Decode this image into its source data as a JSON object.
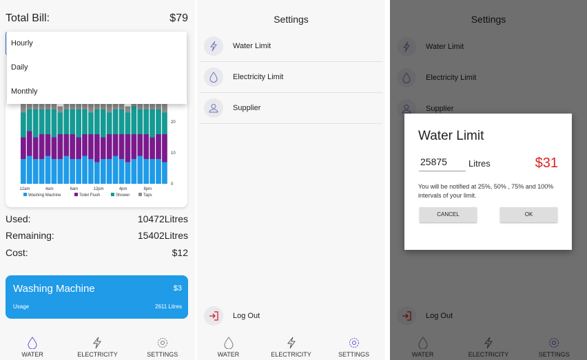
{
  "panel1": {
    "total_label": "Total Bill:",
    "total_value": "$79",
    "dropdown_options": [
      "Hourly",
      "Daily",
      "Monthly"
    ],
    "stats": [
      {
        "label": "Used:",
        "value": "10472Litres"
      },
      {
        "label": "Remaining:",
        "value": "15402Litres"
      },
      {
        "label": "Cost:",
        "value": "$12"
      }
    ],
    "card": {
      "title": "Washing Machine",
      "price": "$3",
      "usage_label": "Usage",
      "usage_value": "2611 Litres"
    }
  },
  "chart_data": {
    "type": "bar",
    "stacked": true,
    "x_tick_labels": [
      "12am",
      "4am",
      "8am",
      "12pm",
      "4pm",
      "8pm"
    ],
    "y_tick_labels": [
      "0",
      "10",
      "20"
    ],
    "legend": [
      "Washing Machine",
      "Toilet Flush",
      "Shower",
      "Taps"
    ],
    "colors": [
      "#1f9be7",
      "#7b1a8c",
      "#159a94",
      "#8c8c8c"
    ],
    "series": [
      {
        "name": "Washing Machine",
        "values": [
          8,
          9,
          8,
          8,
          9,
          8,
          8,
          9,
          8,
          8,
          9,
          8,
          7,
          8,
          8,
          9,
          8,
          7,
          8,
          9,
          8,
          8,
          8,
          7
        ]
      },
      {
        "name": "Toilet Flush",
        "values": [
          7,
          8,
          7,
          8,
          7,
          7,
          8,
          7,
          8,
          7,
          7,
          8,
          9,
          7,
          8,
          7,
          8,
          9,
          8,
          7,
          8,
          7,
          8,
          9
        ]
      },
      {
        "name": "Shower",
        "values": [
          8,
          7,
          9,
          8,
          8,
          9,
          7,
          8,
          8,
          9,
          8,
          7,
          8,
          9,
          7,
          8,
          8,
          7,
          9,
          8,
          8,
          9,
          8,
          7
        ]
      },
      {
        "name": "Taps",
        "values": [
          3,
          2,
          3,
          3,
          2,
          3,
          2,
          3,
          3,
          2,
          3,
          3,
          2,
          3,
          3,
          2,
          3,
          2,
          3,
          3,
          2,
          3,
          2,
          3
        ]
      }
    ]
  },
  "settings": {
    "title": "Settings",
    "items": [
      {
        "label": "Water Limit",
        "icon": "lightning-icon"
      },
      {
        "label": "Electricity Limit",
        "icon": "water-drop-icon"
      },
      {
        "label": "Supplier",
        "icon": "user-icon"
      }
    ],
    "logout": "Log Out"
  },
  "modal": {
    "title": "Water Limit",
    "input_value": "25875",
    "unit": "Litres",
    "price": "$31",
    "message": "You will be notified at 25%, 50% , 75% and 100% intervals of your limit.",
    "cancel": "CANCEL",
    "ok": "OK"
  },
  "nav": {
    "water": "WATER",
    "electricity": "ELECTRICITY",
    "settings": "SETTINGS"
  },
  "colors": {
    "accent_blue": "#1f9be7",
    "nav_active": "#6a4bd0",
    "price_red": "#e02020",
    "logout_red": "#d42020"
  }
}
